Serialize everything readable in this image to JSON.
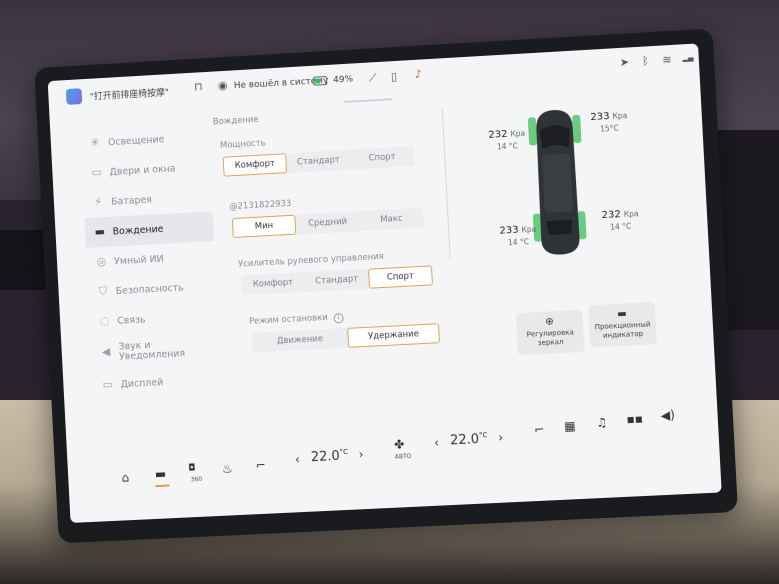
{
  "status_bar": {
    "voice_hint": "\"打开前排座椅按摩\"",
    "login_text": "Не вошёл в систему",
    "battery_percent": "49%"
  },
  "sidebar": {
    "items": [
      {
        "label": "Освещение",
        "icon": "light-icon"
      },
      {
        "label": "Двери и окна",
        "icon": "door-icon"
      },
      {
        "label": "Батарея",
        "icon": "battery-bolt-icon"
      },
      {
        "label": "Вождение",
        "icon": "car-icon"
      },
      {
        "label": "Умный ИИ",
        "icon": "steering-wheel-icon"
      },
      {
        "label": "Безопасность",
        "icon": "shield-icon"
      },
      {
        "label": "Связь",
        "icon": "connection-icon"
      },
      {
        "label": "Звук и",
        "label2": "Уведомления",
        "icon": "speaker-icon"
      },
      {
        "label": "Дисплей",
        "icon": "display-icon"
      }
    ],
    "active_index": 3
  },
  "driving": {
    "section_title": "Вождение",
    "power": {
      "label": "Мощность",
      "options": [
        "Комфорт",
        "Стандарт",
        "Спорт"
      ],
      "selected": 0
    },
    "custom": {
      "label": "@2131822933",
      "options": [
        "Мин",
        "Средний",
        "Макс"
      ],
      "selected": 0
    },
    "steering": {
      "label": "Усилитель рулевого управления",
      "options": [
        "Комфорт",
        "Стандарт",
        "Спорт"
      ],
      "selected": 2
    },
    "stop_mode": {
      "label": "Режим остановки",
      "options": [
        "Движение",
        "Удержание"
      ],
      "selected": 1
    }
  },
  "tyres": {
    "front_left": {
      "pressure": "232",
      "unit": "Кра",
      "temp": "14 °C"
    },
    "front_right": {
      "pressure": "233",
      "unit": "Кра",
      "temp": "15°C"
    },
    "rear_left": {
      "pressure": "233",
      "unit": "Кра",
      "temp": "14 °C"
    },
    "rear_right": {
      "pressure": "232",
      "unit": "Кра",
      "temp": "14 °C"
    }
  },
  "cards": [
    {
      "label1": "Регулировка",
      "label2": "зеркал"
    },
    {
      "label1": "Проекционный",
      "label2": "индикатор"
    }
  ],
  "dock": {
    "left_temp": "22.0",
    "right_temp": "22.0",
    "deg": "°C",
    "fan_label": "АВТО",
    "cam_label": "360"
  },
  "colors": {
    "accent": "#e09a3c",
    "tyre_green": "#3bbf5a"
  }
}
